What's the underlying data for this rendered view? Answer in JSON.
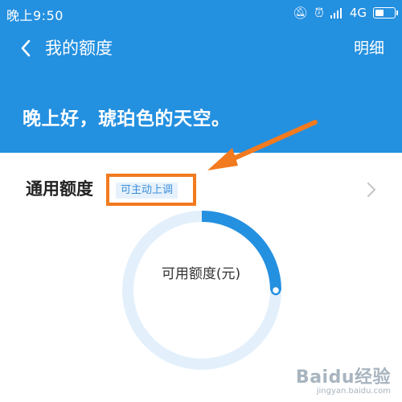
{
  "status_bar": {
    "time": "晚上9:50",
    "network": "4G",
    "icons": [
      "mute-icon",
      "alarm-icon",
      "signal-icon",
      "battery-icon"
    ]
  },
  "app_bar": {
    "title": "我的额度",
    "action": "明细",
    "back_icon": "chevron-left-icon"
  },
  "hero": {
    "greeting": "晚上好，琥珀色的天空。"
  },
  "quota": {
    "title": "通用额度",
    "tag": "可主动上调",
    "available_label": "可用额度(元)",
    "used_fraction": 0.25
  },
  "colors": {
    "primary": "#2490e0",
    "gauge_track": "#e3f0fc",
    "gauge_progress": "#2490e0",
    "annotation": "#f27a1f"
  },
  "watermark": {
    "logo": "Baidu经验",
    "url": "jingyan.baidu.com"
  }
}
